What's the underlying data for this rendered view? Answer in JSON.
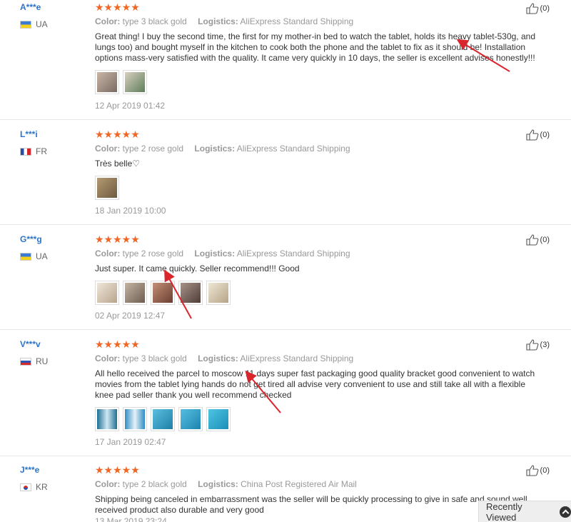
{
  "reviews": [
    {
      "user": "A***e",
      "country": "UA",
      "flag": "ua",
      "stars": "★★★★★",
      "color_label": "Color:",
      "color_value": "type 3 black gold",
      "logistics_label": "Logistics:",
      "logistics_value": "AliExpress Standard Shipping",
      "text": "Great thing! I buy the second time, the first for my mother-in bed to watch the tablet, holds its heavy tablet-530g, and lungs too) and bought myself in the kitchen to cook both the phone and the tablet to fix as it should be! Installation options mass-very satisfied with the quality. It came very quickly in 10 days, the seller is excellent advises honestly!!!",
      "date": "12 Apr 2019 01:42",
      "likes": "(0)",
      "thumbs": [
        "#8a7a70",
        "#6e8c6a"
      ]
    },
    {
      "user": "L***i",
      "country": "FR",
      "flag": "fr",
      "stars": "★★★★★",
      "color_label": "Color:",
      "color_value": "type 2 rose gold",
      "logistics_label": "Logistics:",
      "logistics_value": "AliExpress Standard Shipping",
      "text": "Très belle♡",
      "date": "18 Jan 2019 10:00",
      "likes": "(0)",
      "thumbs": [
        "#8c7656"
      ]
    },
    {
      "user": "G***g",
      "country": "UA",
      "flag": "ua",
      "stars": "★★★★★",
      "color_label": "Color:",
      "color_value": "type 2 rose gold",
      "logistics_label": "Logistics:",
      "logistics_value": "AliExpress Standard Shipping",
      "text": "Just super. It came quickly. Seller recommend!!! Good",
      "date": "02 Apr 2019 12:47",
      "likes": "(0)",
      "thumbs": [
        "#d6c8b8",
        "#9a8a7c",
        "#a4705a",
        "#7e6a62",
        "#cdbfa8"
      ]
    },
    {
      "user": "V***v",
      "country": "RU",
      "flag": "ru",
      "stars": "★★★★★",
      "color_label": "Color:",
      "color_value": "type 3 black gold",
      "logistics_label": "Logistics:",
      "logistics_value": "AliExpress Standard Shipping",
      "text": "All hello received the parcel to moscow 11 days super fast packaging good quality bracket good convenient to watch movies from the tablet lying hands do not get tired all advise very convenient to use and still take all with a flexible knee pad seller thank you well recommend checked",
      "date": "17 Jan 2019 02:47",
      "likes": "(3)",
      "thumbs": [
        "#2e7fa0",
        "#3b8cc0",
        "#2fa6c8",
        "#2a9bc4",
        "#28a8c8"
      ]
    },
    {
      "user": "J***e",
      "country": "KR",
      "flag": "kr",
      "stars": "★★★★★",
      "color_label": "Color:",
      "color_value": "type 2 black gold",
      "logistics_label": "Logistics:",
      "logistics_value": "China Post Registered Air Mail",
      "text": "Shipping being canceled in embarrassment was the seller will be quickly processing to give in safe and sound well received product also durable and very good",
      "date": "13 Mar 2019 23:24",
      "likes": "(0)",
      "thumbs": []
    }
  ],
  "recently_viewed": {
    "label": "Recently Viewed"
  },
  "colors": {
    "accent": "#f26522",
    "link": "#2c74c9",
    "annotation_arrow": "#d9262c"
  },
  "icons": {
    "like": "thumbs-up-icon",
    "up": "chevron-up-icon"
  }
}
